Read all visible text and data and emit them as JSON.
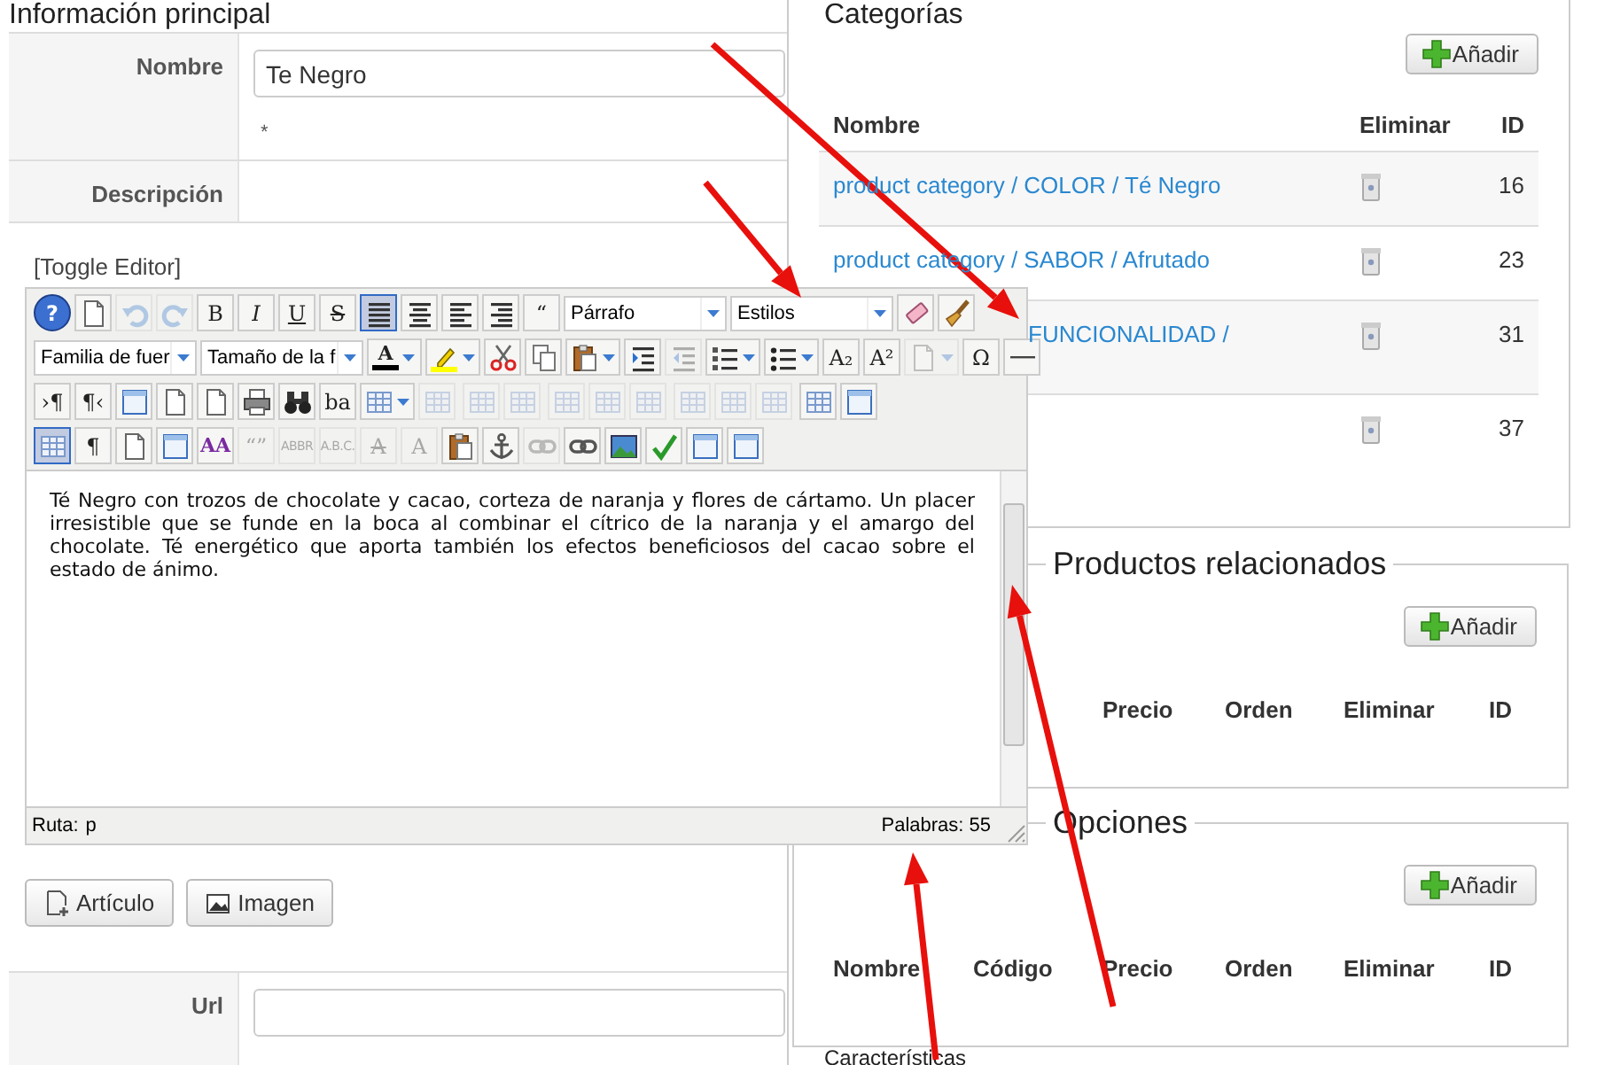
{
  "main_info": {
    "title": "Información principal",
    "fields": [
      {
        "label": "Nombre",
        "value": "Te Negro",
        "note": "*"
      },
      {
        "label": "Descripción"
      }
    ]
  },
  "toggle_editor": "[Toggle Editor]",
  "editor": {
    "toolbar": [
      [
        {
          "kind": "help",
          "label": "?"
        },
        {
          "kind": "icon",
          "selected": false,
          "disabled": false
        },
        {
          "kind": "icon",
          "selected": false,
          "disabled": true
        },
        {
          "kind": "icon",
          "selected": false,
          "disabled": true
        },
        {
          "kind": "text",
          "label": "B",
          "selected": false,
          "disabled": false
        },
        {
          "kind": "text",
          "label": "I",
          "selected": false,
          "disabled": false
        },
        {
          "kind": "text",
          "label": "U",
          "selected": false,
          "disabled": false
        },
        {
          "kind": "text",
          "label": "S",
          "selected": false,
          "disabled": false
        },
        {
          "kind": "icon",
          "selected": true,
          "disabled": false
        },
        {
          "kind": "icon",
          "selected": false,
          "disabled": false
        },
        {
          "kind": "icon",
          "selected": false,
          "disabled": false
        },
        {
          "kind": "icon",
          "selected": false,
          "disabled": false
        },
        {
          "kind": "text",
          "label": "“",
          "selected": false,
          "disabled": false
        },
        {
          "kind": "select",
          "value": "Párrafo"
        },
        {
          "kind": "select",
          "value": "Estilos"
        },
        {
          "kind": "icon",
          "selected": false,
          "disabled": false
        },
        {
          "kind": "icon",
          "selected": false,
          "disabled": false
        }
      ],
      [
        {
          "kind": "select",
          "value": "Familia de fuer"
        },
        {
          "kind": "select",
          "value": "Tamaño de la f"
        },
        {
          "kind": "color",
          "label": "A",
          "color": "#000000"
        },
        {
          "kind": "color",
          "color": "#ffff00"
        },
        {
          "kind": "icon",
          "selected": false,
          "disabled": false
        },
        {
          "kind": "icon",
          "selected": false,
          "disabled": false
        },
        {
          "kind": "split",
          "selected": false,
          "disabled": false
        },
        {
          "kind": "icon",
          "selected": false,
          "disabled": false
        },
        {
          "kind": "icon",
          "selected": false,
          "disabled": true
        },
        {
          "kind": "split",
          "selected": false,
          "disabled": false
        },
        {
          "kind": "split",
          "selected": false,
          "disabled": false
        },
        {
          "kind": "text",
          "label": "A₂",
          "selected": false,
          "disabled": false
        },
        {
          "kind": "text",
          "label": "A²",
          "selected": false,
          "disabled": false
        },
        {
          "kind": "split",
          "selected": false,
          "disabled": true
        },
        {
          "kind": "text",
          "label": "Ω",
          "selected": false,
          "disabled": false
        },
        {
          "kind": "icon",
          "selected": false,
          "disabled": false
        }
      ],
      [
        {
          "kind": "text",
          "label": "›¶",
          "selected": false,
          "disabled": false
        },
        {
          "kind": "text",
          "label": "¶‹",
          "selected": false,
          "disabled": false
        },
        {
          "kind": "icon",
          "selected": false,
          "disabled": false
        },
        {
          "kind": "icon",
          "selected": false,
          "disabled": false
        },
        {
          "kind": "icon",
          "selected": false,
          "disabled": false
        },
        {
          "kind": "icon",
          "selected": false,
          "disabled": false
        },
        {
          "kind": "icon",
          "selected": false,
          "disabled": false
        },
        {
          "kind": "text",
          "label": "ba",
          "selected": false,
          "disabled": false
        },
        {
          "kind": "split",
          "selected": false,
          "disabled": false
        },
        {
          "kind": "icon",
          "selected": false,
          "disabled": true
        },
        {
          "kind": "separator"
        },
        {
          "kind": "icon",
          "selected": false,
          "disabled": true
        },
        {
          "kind": "icon",
          "selected": false,
          "disabled": true
        },
        {
          "kind": "separator"
        },
        {
          "kind": "icon",
          "selected": false,
          "disabled": true
        },
        {
          "kind": "icon",
          "selected": false,
          "disabled": true
        },
        {
          "kind": "icon",
          "selected": false,
          "disabled": true
        },
        {
          "kind": "separator"
        },
        {
          "kind": "icon",
          "selected": false,
          "disabled": true
        },
        {
          "kind": "icon",
          "selected": false,
          "disabled": true
        },
        {
          "kind": "icon",
          "selected": false,
          "disabled": true
        },
        {
          "kind": "separator"
        },
        {
          "kind": "icon",
          "selected": false,
          "disabled": false
        },
        {
          "kind": "icon",
          "selected": false,
          "disabled": false
        }
      ],
      [
        {
          "kind": "icon",
          "selected": true,
          "disabled": false
        },
        {
          "kind": "text",
          "label": "¶",
          "selected": false,
          "disabled": false
        },
        {
          "kind": "icon",
          "selected": false,
          "disabled": false
        },
        {
          "kind": "icon",
          "selected": false,
          "disabled": false
        },
        {
          "kind": "text",
          "label": "AA",
          "selected": false,
          "disabled": false
        },
        {
          "kind": "text",
          "label": "“”",
          "selected": false,
          "disabled": true
        },
        {
          "kind": "text",
          "label": "ABBR",
          "selected": false,
          "disabled": true
        },
        {
          "kind": "text",
          "label": "A.B.C.",
          "selected": false,
          "disabled": true
        },
        {
          "kind": "text",
          "label": "A",
          "selected": false,
          "disabled": true
        },
        {
          "kind": "text",
          "label": "A",
          "selected": false,
          "disabled": true
        },
        {
          "kind": "icon",
          "selected": false,
          "disabled": false
        },
        {
          "kind": "icon",
          "selected": false,
          "disabled": false
        },
        {
          "kind": "icon",
          "selected": false,
          "disabled": true
        },
        {
          "kind": "icon",
          "selected": false,
          "disabled": false
        },
        {
          "kind": "icon",
          "selected": false,
          "disabled": false
        },
        {
          "kind": "icon",
          "selected": false,
          "disabled": false
        },
        {
          "kind": "icon",
          "selected": false,
          "disabled": false
        },
        {
          "kind": "icon",
          "selected": false,
          "disabled": false
        }
      ]
    ],
    "content": "Té Negro con trozos de chocolate y cacao, corteza de naranja y flores de cártamo. Un placer irresistible que se funde en la boca al combinar el cítrico de la naranja y el amargo del chocolate. Té energético que aporta también los efectos beneficiosos del cacao sobre el estado de ánimo.",
    "path_label": "Ruta:",
    "path": "p",
    "word_count": "Palabras: 55"
  },
  "insert_buttons": [
    {
      "label": "Artículo"
    },
    {
      "label": "Imagen"
    }
  ],
  "url_field": {
    "label": "Url"
  },
  "categories": {
    "title": "Categorías",
    "add_button": "Añadir",
    "columns": [
      "Nombre",
      "Eliminar",
      "ID"
    ],
    "rows": [
      {
        "name": "product category / COLOR / Té Negro",
        "id": "16",
        "partly_hidden": false
      },
      {
        "name": "product category / SABOR / Afrutado",
        "id": "23",
        "partly_hidden": false
      },
      {
        "name": "FUNCIONALIDAD /",
        "id": "31",
        "partly_hidden": true
      },
      {
        "id": "37",
        "partly_hidden": true
      }
    ]
  },
  "related_products": {
    "title": "Productos relacionados",
    "add_button": "Añadir",
    "columns": [
      "Precio",
      "Orden",
      "Eliminar",
      "ID"
    ]
  },
  "options": {
    "title": "Opciones",
    "add_button": "Añadir",
    "columns": [
      "Nombre",
      "Código",
      "Precio",
      "Orden",
      "Eliminar",
      "ID"
    ]
  },
  "next_section": {
    "title": "Características"
  }
}
